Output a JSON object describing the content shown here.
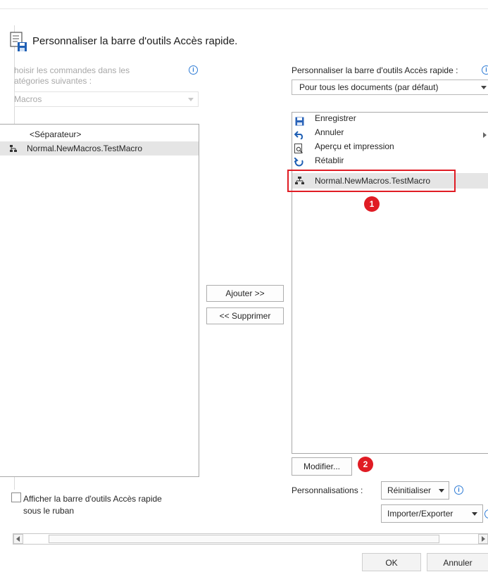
{
  "dialog": {
    "title": "Personnaliser la barre d'outils Accès rapide."
  },
  "left": {
    "choose_label_line1": "hoisir les commandes dans les",
    "choose_label_line2": "atégories suivantes :",
    "category_value": "Macros",
    "items": [
      {
        "label": "<Séparateur>"
      },
      {
        "label": "Normal.NewMacros.TestMacro"
      }
    ],
    "show_below_ribbon_line1": "Afficher la barre d'outils Accès rapide",
    "show_below_ribbon_line2": "sous le ruban"
  },
  "middle": {
    "add_label": "Ajouter >>",
    "remove_label": "<< Supprimer"
  },
  "right": {
    "customize_label": "Personnaliser la barre d'outils Accès rapide :",
    "scope_value": "Pour tous les documents (par défaut)",
    "items": [
      {
        "label": "Enregistrer",
        "icon": "save-icon"
      },
      {
        "label": "Annuler",
        "icon": "undo-icon"
      },
      {
        "label": "Aperçu et impression",
        "icon": "print-preview-icon"
      },
      {
        "label": "Rétablir",
        "icon": "redo-icon"
      },
      {
        "label": "Normal.NewMacros.TestMacro",
        "icon": "macro-icon"
      }
    ],
    "modify_label": "Modifier...",
    "customizations_label": "Personnalisations :",
    "reset_label": "Réinitialiser",
    "import_export_label": "Importer/Exporter"
  },
  "annotations": {
    "badge1": "1",
    "badge2": "2",
    "color": "#e01c24"
  },
  "footer": {
    "ok_label": "OK",
    "cancel_label": "Annuler"
  }
}
